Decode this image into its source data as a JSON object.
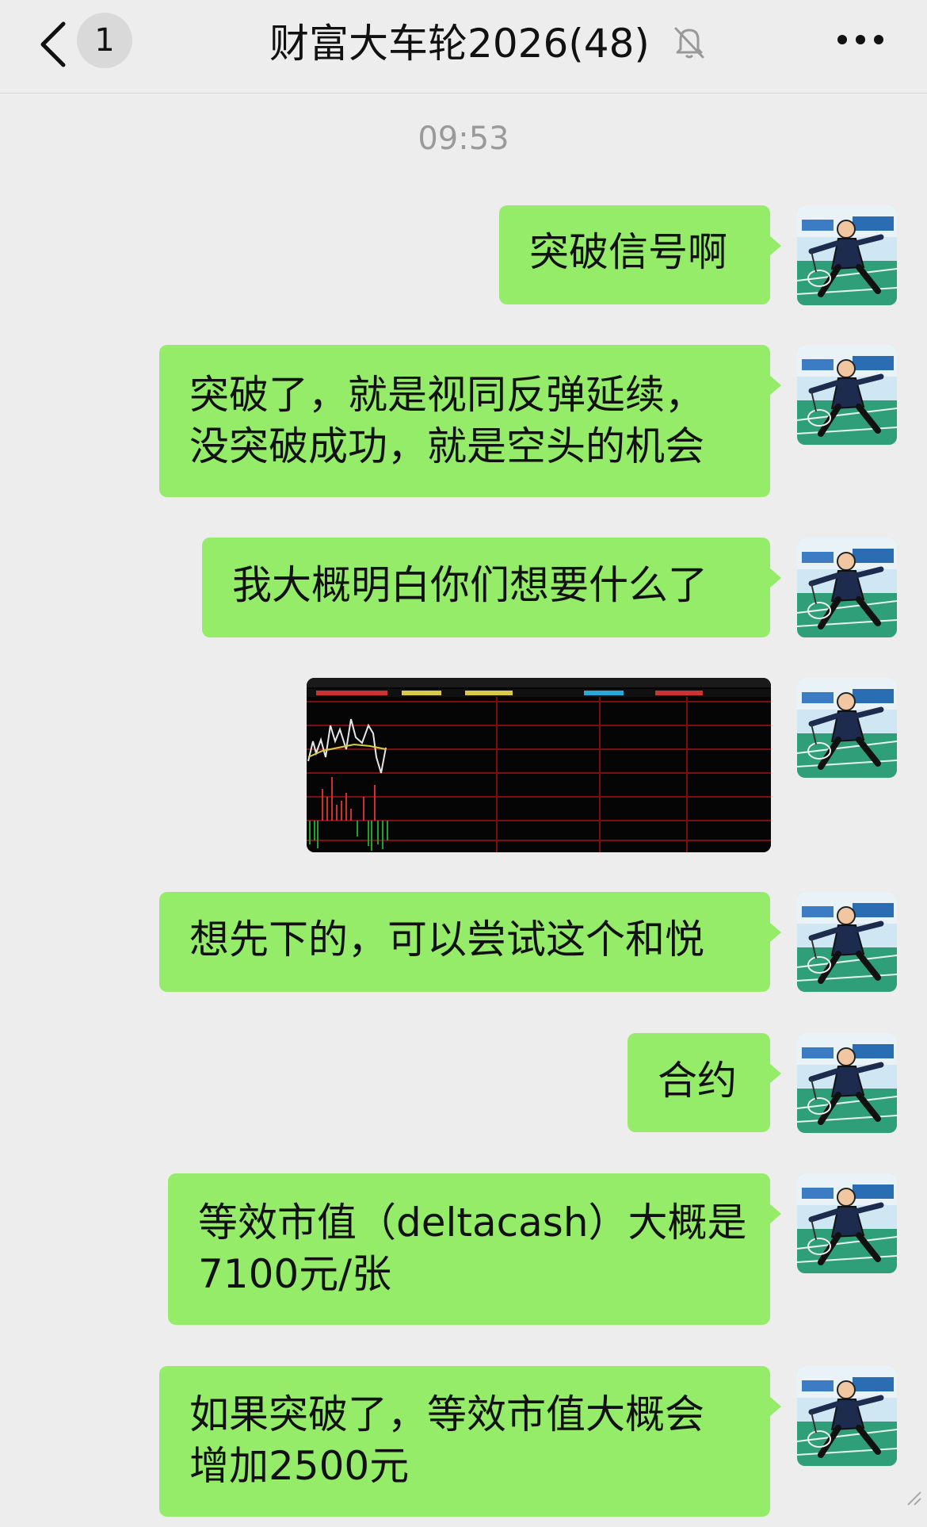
{
  "header": {
    "back_label": "back",
    "unread_count": "1",
    "title": "财富大车轮2026(48)",
    "muted": true
  },
  "timestamp": "09:53",
  "messages": [
    {
      "type": "text",
      "text": "突破信号啊"
    },
    {
      "type": "text",
      "text": "突破了，就是视同反弹延续，\n没突破成功，就是空头的机会"
    },
    {
      "type": "text",
      "text": "我大概明白你们想要什么了"
    },
    {
      "type": "image",
      "description": "intraday stock chart screenshot"
    },
    {
      "type": "text",
      "text": "想先下的，可以尝试这个和悦"
    },
    {
      "type": "text",
      "text": "合约"
    },
    {
      "type": "text",
      "text": "等效市值（deltacash）大概是\n7100元/张"
    },
    {
      "type": "text",
      "text": "如果突破了，等效市值大概会\n增加2500元"
    }
  ],
  "colors": {
    "bubble": "#95ec69",
    "background": "#ededed",
    "timestamp": "#9a9a9a"
  },
  "icons": {
    "back": "chevron-left-icon",
    "mute": "bell-off-icon",
    "more": "more-dots-icon"
  }
}
